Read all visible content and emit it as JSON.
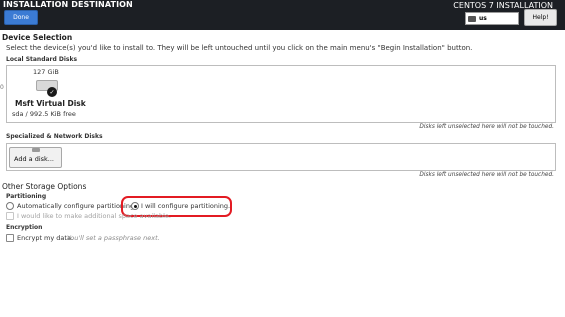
{
  "header": {
    "title": "INSTALLATION DESTINATION",
    "done_label": "Done",
    "product": "CENTOS 7 INSTALLATION",
    "keyboard_layout": "us",
    "help_label": "Help!"
  },
  "device_selection": {
    "heading": "Device Selection",
    "description": "Select the device(s) you'd like to install to.  They will be left untouched until you click on the main menu's \"Begin Installation\" button.",
    "local_heading": "Local Standard Disks",
    "local_disks": [
      {
        "size": "127 GiB",
        "name": "Msft Virtual Disk",
        "meta": "sda  /  992.5 KiB free",
        "selected": true
      }
    ],
    "left_marker": "0",
    "unselected_note": "Disks left unselected here will not be touched.",
    "specialized_heading": "Specialized & Network Disks",
    "add_disk_label": "Add a disk...",
    "specialized_note": "Disks left unselected here will not be touched."
  },
  "other_storage": {
    "heading": "Other Storage Options",
    "partitioning_heading": "Partitioning",
    "auto_label": "Automatically configure partitioning.",
    "manual_label": "I will configure partitioning.",
    "partitioning_selected": "manual",
    "additional_space_label": "I would like to make additional space available.",
    "encryption_heading": "Encryption",
    "encrypt_label": "Encrypt my data.",
    "encrypt_hint": "You'll set a passphrase next."
  },
  "colors": {
    "header_bg": "#1c1f24",
    "done_button": "#3b7bd4",
    "highlight_oval": "#e31b23"
  },
  "icons": {
    "disk": "hard-disk-icon",
    "selected": "checkmark-icon",
    "keyboard": "keyboard-icon",
    "add_disk": "disk-icon"
  }
}
